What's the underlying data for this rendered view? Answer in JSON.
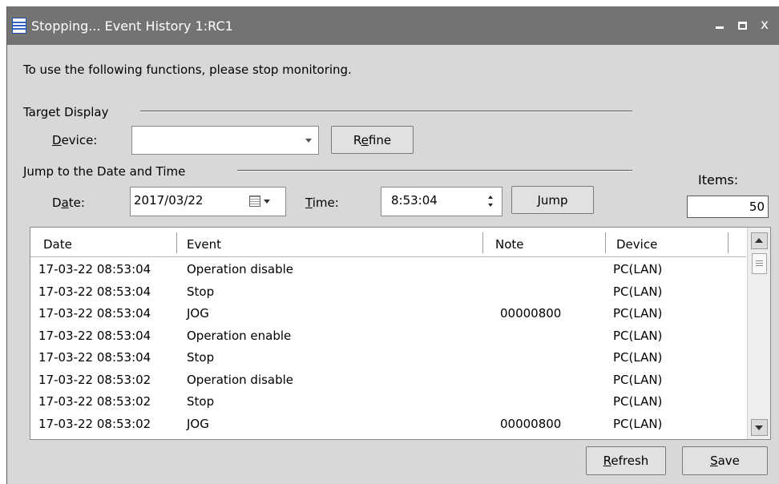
{
  "window": {
    "title": "Stopping...  Event History 1:RC1",
    "close_glyph": "x"
  },
  "notice": "To use the following functions, please stop monitoring.",
  "target_display": {
    "group_label": "Target Display",
    "device_label_pre": "",
    "device_label_key": "D",
    "device_label_post": "evice:",
    "device_value": "",
    "refine_pre": "R",
    "refine_key": "e",
    "refine_post": "fine"
  },
  "jump": {
    "group_label": "Jump to the Date and Time",
    "date_label_pre": "D",
    "date_label_key": "a",
    "date_label_post": "te:",
    "date_value": "2017/03/22",
    "time_label_pre": "",
    "time_label_key": "T",
    "time_label_post": "ime:",
    "time_value": "8:53:04",
    "jump_pre": "",
    "jump_key": "J",
    "jump_post": "ump"
  },
  "items": {
    "label": "Items:",
    "value": "50"
  },
  "table": {
    "columns": [
      "Date",
      "Event",
      "Note",
      "Device"
    ],
    "rows": [
      {
        "date": "17-03-22 08:53:04",
        "event": "Operation disable",
        "note": "",
        "device": "PC(LAN)"
      },
      {
        "date": "17-03-22 08:53:04",
        "event": "Stop",
        "note": "",
        "device": "PC(LAN)"
      },
      {
        "date": "17-03-22 08:53:04",
        "event": "JOG",
        "note": "00000800",
        "device": "PC(LAN)"
      },
      {
        "date": "17-03-22 08:53:04",
        "event": "Operation enable",
        "note": "",
        "device": "PC(LAN)"
      },
      {
        "date": "17-03-22 08:53:04",
        "event": "Stop",
        "note": "",
        "device": "PC(LAN)"
      },
      {
        "date": "17-03-22 08:53:02",
        "event": "Operation disable",
        "note": "",
        "device": "PC(LAN)"
      },
      {
        "date": "17-03-22 08:53:02",
        "event": "Stop",
        "note": "",
        "device": "PC(LAN)"
      },
      {
        "date": "17-03-22 08:53:02",
        "event": "JOG",
        "note": "00000800",
        "device": "PC(LAN)"
      }
    ]
  },
  "footer": {
    "refresh_pre": "",
    "refresh_key": "R",
    "refresh_post": "efresh",
    "save_pre": "",
    "save_key": "S",
    "save_post": "ave"
  }
}
